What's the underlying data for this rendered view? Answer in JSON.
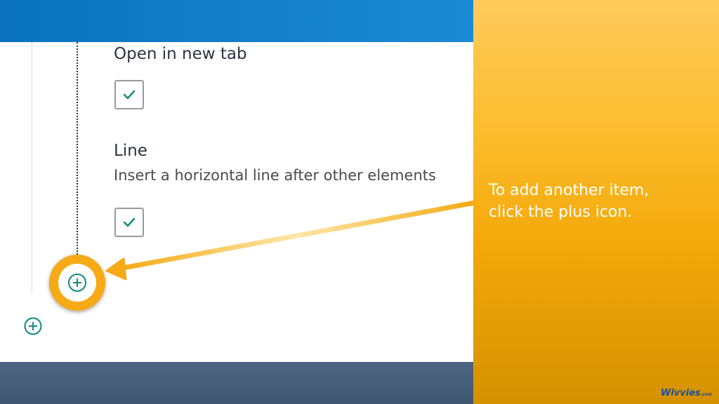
{
  "form": {
    "open_in_new_tab": {
      "label": "Open in new tab",
      "checked": true
    },
    "line": {
      "label": "Line",
      "description": "Insert a horizontal line after other elements",
      "checked": true
    }
  },
  "add_buttons": [
    {
      "icon": "plus-circle-icon",
      "highlighted": true
    },
    {
      "icon": "plus-circle-icon",
      "highlighted": false
    }
  ],
  "callout": {
    "line1": "To add another item,",
    "line2": "click the plus icon."
  },
  "brand": {
    "name": "Wivvies",
    "suffix": ".com"
  },
  "colors": {
    "header_blue": "#0a72be",
    "footer_slate": "#4e6583",
    "accent_orange": "#f5aa16",
    "check_teal": "#0f8a7e"
  }
}
